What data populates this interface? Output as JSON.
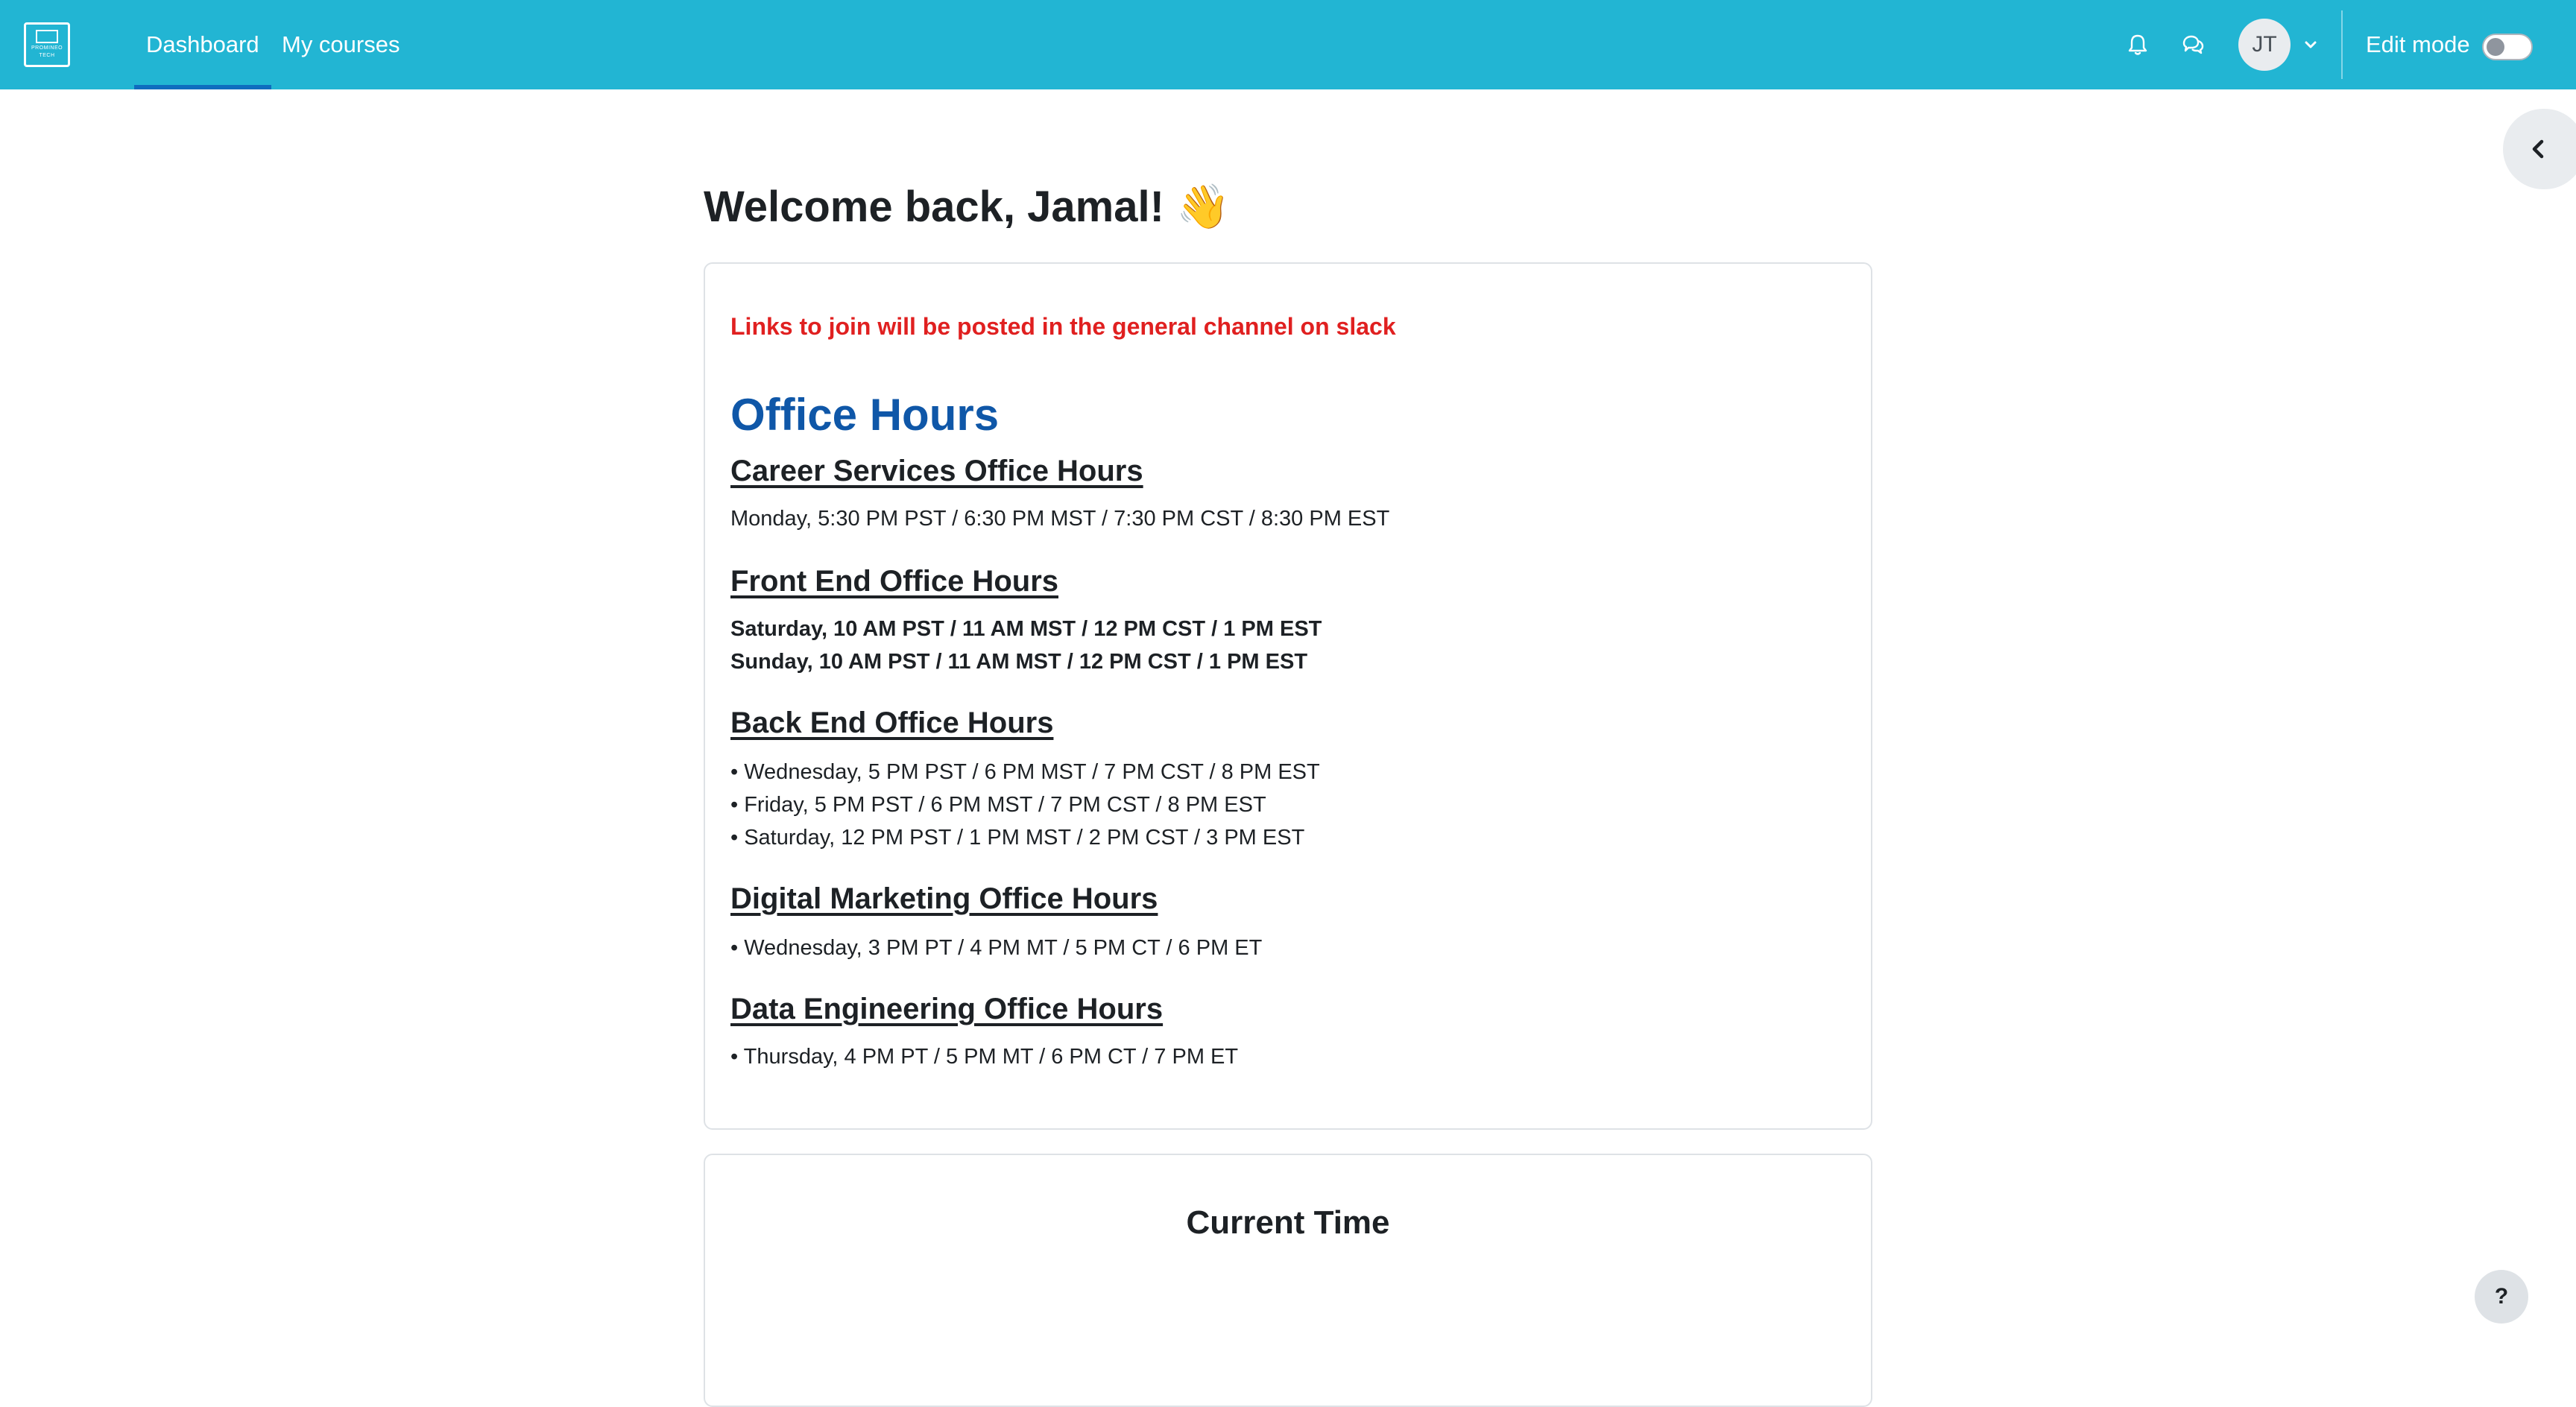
{
  "navbar": {
    "logo_text": "PROMINEO TECH",
    "links": [
      {
        "label": "Dashboard",
        "active": true
      },
      {
        "label": "My courses",
        "active": false
      }
    ],
    "icons": [
      "bell-icon",
      "chat-icon"
    ],
    "avatar_initials": "JT",
    "edit_mode_label": "Edit mode",
    "edit_mode_on": false,
    "bg_color": "#22b5d3"
  },
  "main": {
    "welcome": "Welcome back, Jamal! 👋",
    "card": {
      "notice": "Links to join will be posted in the general channel on slack",
      "heading": "Office Hours",
      "sections": [
        {
          "title": "Career Services Office Hours",
          "lines": [
            "Monday, 5:30 PM PST / 6:30 PM MST / 7:30 PM CST / 8:30 PM EST"
          ]
        },
        {
          "title": "Front End Office Hours",
          "lines": [
            "Saturday, 10 AM PST / 11 AM MST / 12 PM CST / 1 PM EST",
            "Sunday, 10 AM PST / 11 AM MST / 12 PM CST / 1 PM EST"
          ]
        },
        {
          "title": "Back End Office Hours",
          "lines": [
            "• Wednesday, 5 PM PST / 6 PM MST / 7 PM CST / 8 PM EST",
            "• Friday, 5 PM PST / 6 PM MST / 7 PM CST / 8 PM EST",
            "• Saturday, 12 PM PST / 1 PM MST / 2 PM CST / 3 PM EST"
          ]
        },
        {
          "title": "Digital Marketing Office Hours",
          "lines": [
            "• Wednesday, 3 PM PT / 4 PM MT / 5 PM CT / 6 PM ET"
          ]
        },
        {
          "title": "Data Engineering Office Hours",
          "lines": [
            "• Thursday, 4 PM PT / 5 PM MT / 6 PM CT / 7 PM ET"
          ]
        }
      ]
    },
    "current_time_title": "Current Time"
  },
  "help_label": "?",
  "colors": {
    "notice": "#e02020",
    "heading": "#0f57a8"
  }
}
